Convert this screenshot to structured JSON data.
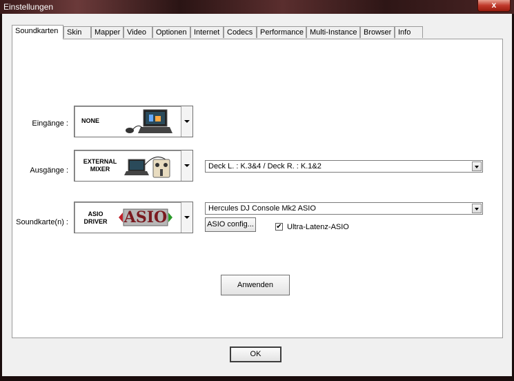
{
  "window": {
    "title": "Einstellungen",
    "close_label": "x"
  },
  "tabs": [
    {
      "label": "Soundkarten",
      "active": true
    },
    {
      "label": "Skin"
    },
    {
      "label": "Mapper"
    },
    {
      "label": "Video"
    },
    {
      "label": "Optionen"
    },
    {
      "label": "Internet"
    },
    {
      "label": "Codecs"
    },
    {
      "label": "Performance"
    },
    {
      "label": "Multi-Instance"
    },
    {
      "label": "Browser"
    },
    {
      "label": "Info"
    }
  ],
  "inputs": {
    "label": "Eingänge :",
    "selected": "NONE"
  },
  "outputs": {
    "label": "Ausgänge :",
    "selected_line1": "EXTERNAL",
    "selected_line2": "MIXER",
    "channel_select": "Deck L. : K.3&4 / Deck R. : K.1&2"
  },
  "soundcard": {
    "label": "Soundkarte(n) :",
    "selected_line1": "ASIO",
    "selected_line2": "DRIVER",
    "logo_text": "ASIO",
    "device_select": "Hercules DJ Console Mk2 ASIO",
    "config_button": "ASIO config...",
    "ultra_latency_label": "Ultra-Latenz-ASIO",
    "ultra_latency_checked": true,
    "check_mark": "✔"
  },
  "apply_button": "Anwenden",
  "ok_button": "OK"
}
